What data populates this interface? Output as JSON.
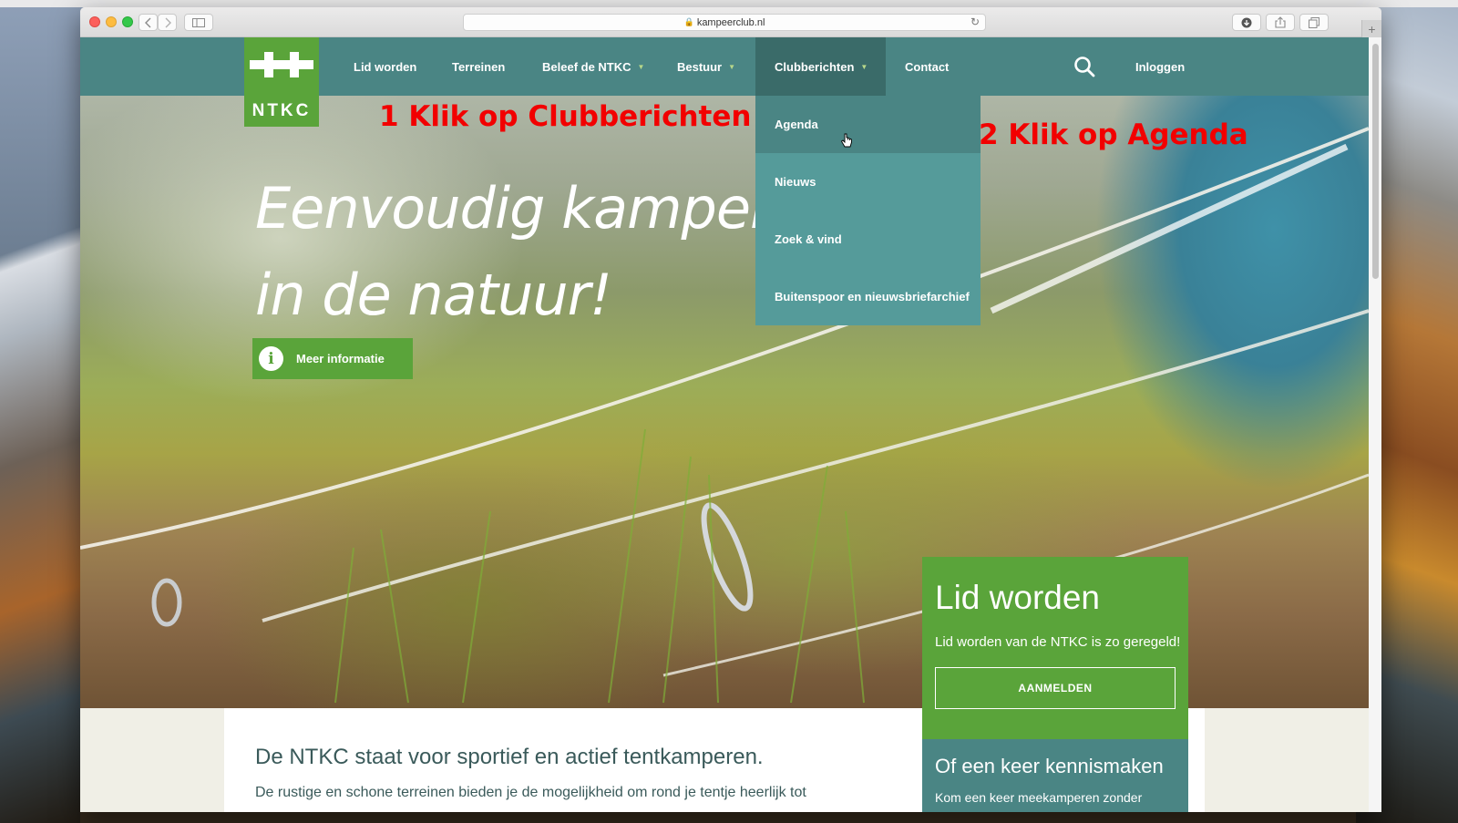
{
  "browser": {
    "url": "kampeerclub.nl"
  },
  "nav": {
    "logo_text": "NTKC",
    "items": [
      {
        "label": "Lid worden"
      },
      {
        "label": "Terreinen"
      },
      {
        "label": "Beleef de NTKC"
      },
      {
        "label": "Bestuur"
      },
      {
        "label": "Clubberichten"
      },
      {
        "label": "Contact"
      }
    ],
    "login_label": "Inloggen"
  },
  "dropdown": {
    "items": [
      {
        "label": "Agenda"
      },
      {
        "label": "Nieuws"
      },
      {
        "label": "Zoek & vind"
      },
      {
        "label": "Buitenspoor en nieuwsbriefarchief"
      }
    ]
  },
  "annotations": {
    "step1": "1 Klik op Clubberichten",
    "step2": "2 Klik op Agenda"
  },
  "hero": {
    "title_line1": "Eenvoudig kamperen",
    "title_line2": "in de natuur!",
    "info_button": "Meer informatie"
  },
  "join": {
    "title": "Lid worden",
    "text": "Lid worden van de NTKC is zo geregeld!",
    "button": "AANMELDEN",
    "meet_title": "Of een keer kennismaken",
    "meet_text": "Kom een keer meekamperen zonder"
  },
  "content": {
    "title": "De NTKC staat voor sportief en actief tentkamperen.",
    "text": "De rustige en schone terreinen bieden je de mogelijkheid om rond je tentje heerlijk tot"
  },
  "colors": {
    "nav": "#4a8584",
    "nav_active": "#3a6b69",
    "dropdown": "#559b9a",
    "brand_green": "#5aa43a",
    "annotation_red": "#f20000"
  }
}
